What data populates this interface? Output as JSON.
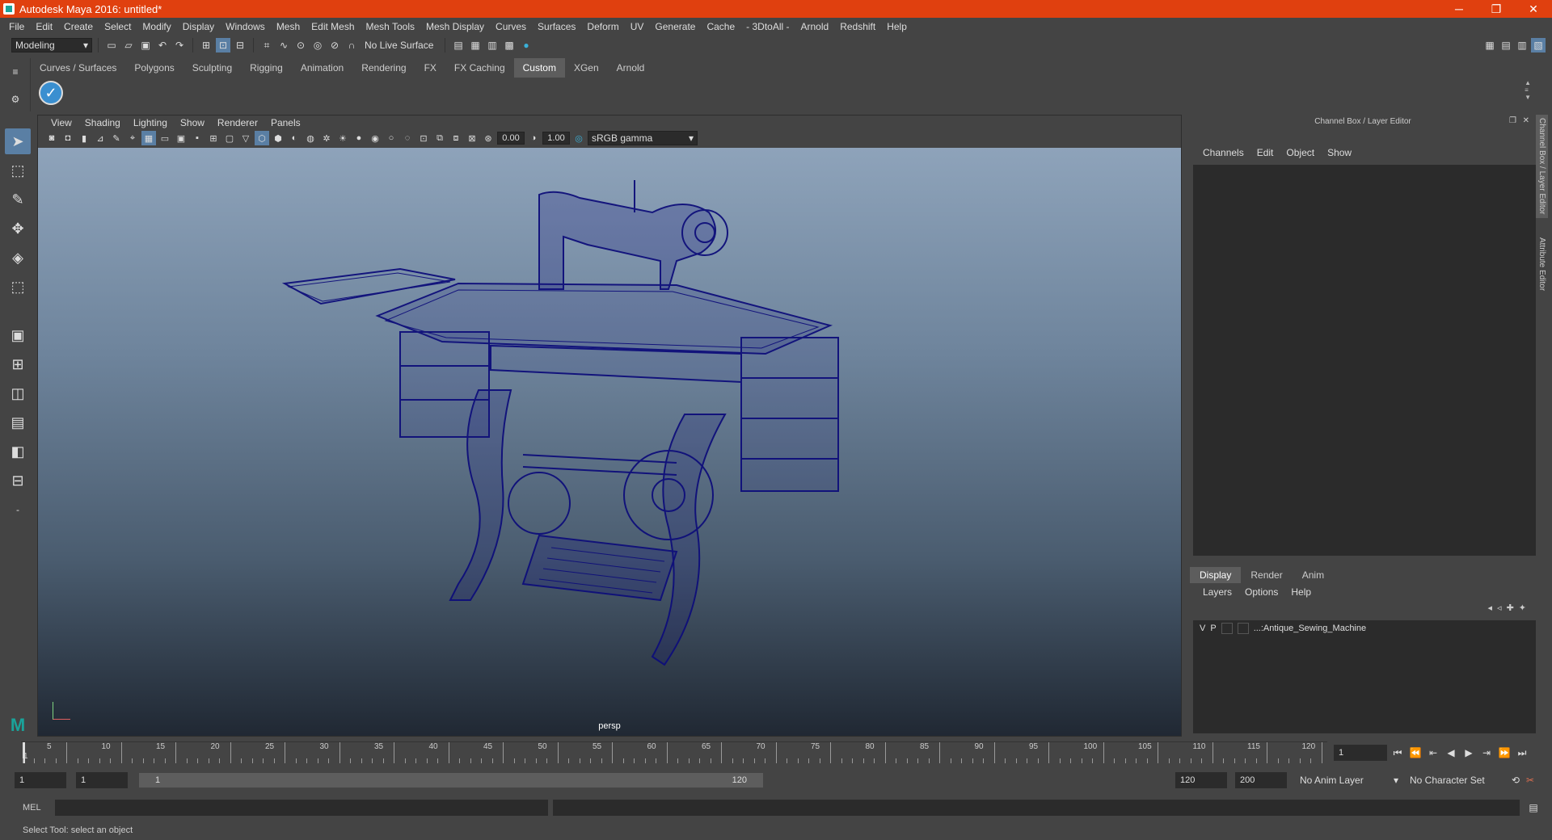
{
  "window": {
    "title": "Autodesk Maya 2016: untitled*",
    "minimize": "─",
    "restore": "❐",
    "close": "✕"
  },
  "menus": [
    "File",
    "Edit",
    "Create",
    "Select",
    "Modify",
    "Display",
    "Windows",
    "Mesh",
    "Edit Mesh",
    "Mesh Tools",
    "Mesh Display",
    "Curves",
    "Surfaces",
    "Deform",
    "UV",
    "Generate",
    "Cache",
    "- 3DtoAll -",
    "Arnold",
    "Redshift",
    "Help"
  ],
  "status": {
    "mode": "Modeling",
    "live_surface": "No Live Surface"
  },
  "shelf_tabs": [
    "Curves / Surfaces",
    "Polygons",
    "Sculpting",
    "Rigging",
    "Animation",
    "Rendering",
    "FX",
    "FX Caching",
    "Custom",
    "XGen",
    "Arnold"
  ],
  "shelf_active": "Custom",
  "viewport": {
    "menus": [
      "View",
      "Shading",
      "Lighting",
      "Show",
      "Renderer",
      "Panels"
    ],
    "exposure": "0.00",
    "gamma": "1.00",
    "color_space": "sRGB gamma",
    "camera_label": "persp"
  },
  "channel_box": {
    "title": "Channel Box / Layer Editor",
    "menus": [
      "Channels",
      "Edit",
      "Object",
      "Show"
    ],
    "layer_tabs": [
      "Display",
      "Render",
      "Anim"
    ],
    "layer_active": "Display",
    "layer_menus": [
      "Layers",
      "Options",
      "Help"
    ],
    "layer": {
      "v": "V",
      "p": "P",
      "name": "...:Antique_Sewing_Machine"
    }
  },
  "side_tabs": [
    "Channel Box / Layer Editor",
    "Attribute Editor"
  ],
  "timeline": {
    "ticks": [
      "5",
      "10",
      "15",
      "20",
      "25",
      "30",
      "35",
      "40",
      "45",
      "50",
      "55",
      "60",
      "65",
      "70",
      "75",
      "80",
      "85",
      "90",
      "95",
      "100",
      "105",
      "110",
      "115",
      "120"
    ],
    "start_marker": "1",
    "current_frame": "1"
  },
  "range": {
    "start": "1",
    "playback_start": "1",
    "slider_start": "1",
    "slider_end": "120",
    "playback_end": "120",
    "end": "200",
    "anim_layer": "No Anim Layer",
    "char_set": "No Character Set"
  },
  "cmd": {
    "label": "MEL"
  },
  "help_line": "Select Tool: select an object",
  "colors": {
    "title_bar": "#e0400f",
    "wireframe": "#0e0e7a",
    "panel": "#444444",
    "field": "#2b2b2b"
  }
}
